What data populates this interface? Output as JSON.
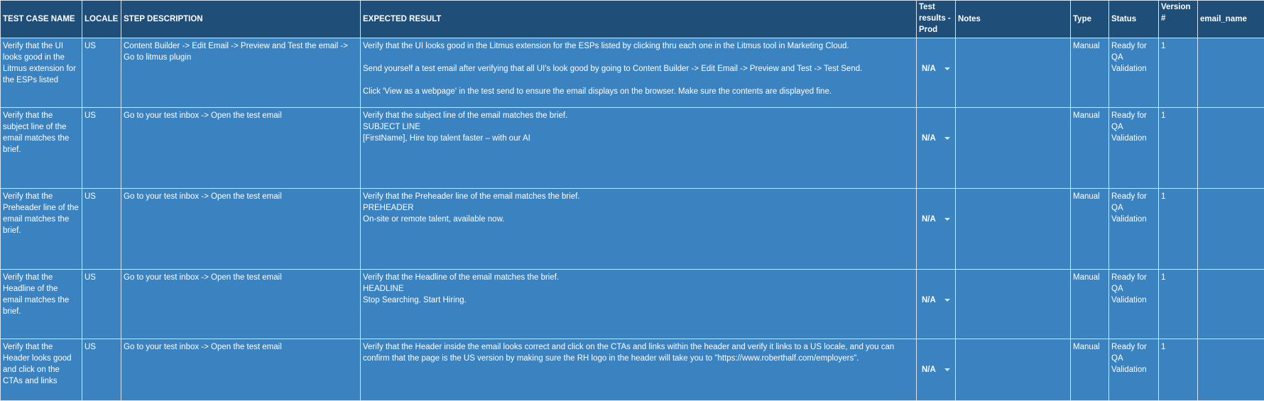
{
  "columns": [
    "TEST CASE NAME",
    "LOCALE",
    "STEP DESCRIPTION",
    "EXPECTED RESULT",
    "Test results - Prod",
    "Notes",
    "Type",
    "Status",
    "Version #",
    "email_name"
  ],
  "rows": [
    {
      "name": "Verify that the UI looks good in the Litmus extension for the ESPs listed",
      "locale": "US",
      "step": "Content Builder -> Edit Email -> Preview and Test the email -> Go to litmus plugin",
      "expected": "Verify that the UI looks good in the Litmus extension for the ESPs listed by clicking thru each one in the Litmus tool in Marketing Cloud.\n\nSend yourself a test email after verifying that all UI's look good by going to Content Builder -> Edit Email -> Preview and Test -> Test Send.\n\nClick 'View as a webpage' in the test send to ensure the email displays on the browser. Make sure the contents are displayed fine.",
      "result": "N/A",
      "notes": "",
      "type": "Manual",
      "status": "Ready for QA Validation",
      "version": "1",
      "email_name": ""
    },
    {
      "name": "Verify that the subject line of the email matches the brief.",
      "locale": "US",
      "step": "Go to your test inbox -> Open the test email",
      "expected": "Verify that the subject line of the email matches the brief.\nSUBJECT LINE\n[FirstName], Hire top talent faster – with our AI",
      "result": "N/A",
      "notes": "",
      "type": "Manual",
      "status": "Ready for QA Validation",
      "version": "1",
      "email_name": ""
    },
    {
      "name": "Verify that the Preheader line of the email matches the brief.",
      "locale": "US",
      "step": "Go to your test inbox -> Open the test email",
      "expected": "Verify that the Preheader line of the email matches the brief.\nPREHEADER\nOn-site or remote talent, available now.",
      "result": "N/A",
      "notes": "",
      "type": "Manual",
      "status": "Ready for QA Validation",
      "version": "1",
      "email_name": ""
    },
    {
      "name": "Verify that the Headline of the email matches the brief.",
      "locale": "US",
      "step": "Go to your test inbox -> Open the test email",
      "expected": "Verify that the Headline of the email matches the brief.\nHEADLINE\nStop Searching. Start Hiring.",
      "result": "N/A",
      "notes": "",
      "type": "Manual",
      "status": "Ready for QA Validation",
      "version": "1",
      "email_name": ""
    },
    {
      "name": "Verify that the Header looks good and click on the CTAs and links",
      "locale": "US",
      "step": "Go to your test inbox -> Open the test email",
      "expected": "Verify that the Header inside the email looks correct and click on the CTAs and links within the header and verify it links to a US locale, and you can confirm that the page is the US version by making sure the RH logo in the header will take you to \"https://www.roberthalf.com/employers\".",
      "result": "N/A",
      "notes": "",
      "type": "Manual",
      "status": "Ready for QA Validation",
      "version": "1",
      "email_name": ""
    }
  ]
}
